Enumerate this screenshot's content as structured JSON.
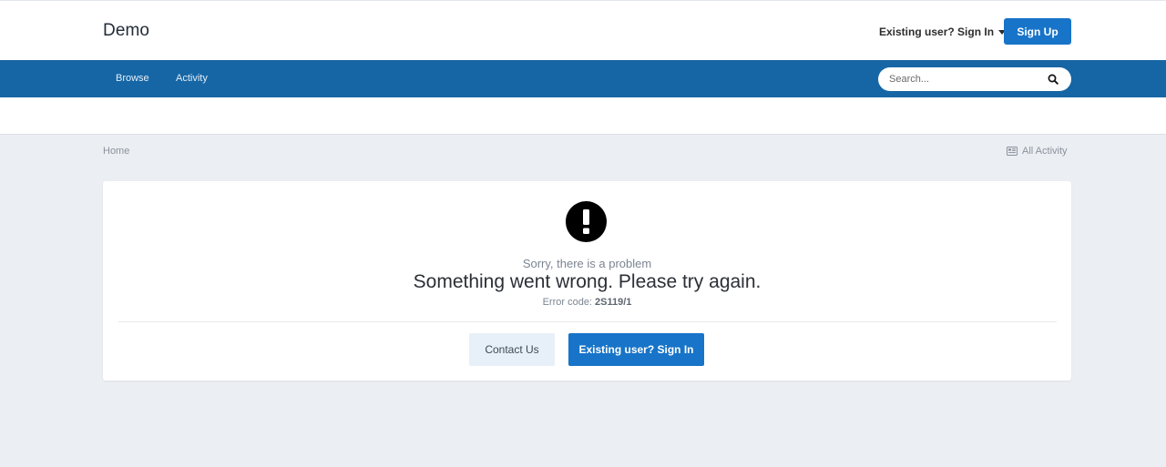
{
  "header": {
    "brand": "Demo",
    "signin_link": "Existing user? Sign In",
    "signup_button": "Sign Up"
  },
  "nav": {
    "items": [
      {
        "label": "Browse"
      },
      {
        "label": "Activity"
      }
    ],
    "search": {
      "placeholder": "Search...",
      "icon": "search-icon"
    }
  },
  "breadcrumb": {
    "home": "Home",
    "all_activity": "All Activity",
    "all_activity_icon": "activity-feed-icon"
  },
  "error": {
    "icon": "exclamation-circle-icon",
    "sorry": "Sorry, there is a problem",
    "headline": "Something went wrong. Please try again.",
    "code_label": "Error code:",
    "code": "2S119/1",
    "contact_button": "Contact Us",
    "signin_button": "Existing user? Sign In"
  },
  "colors": {
    "brand_blue": "#1774c8",
    "nav_blue": "#1666a5",
    "page_bg": "#ebeef2"
  }
}
